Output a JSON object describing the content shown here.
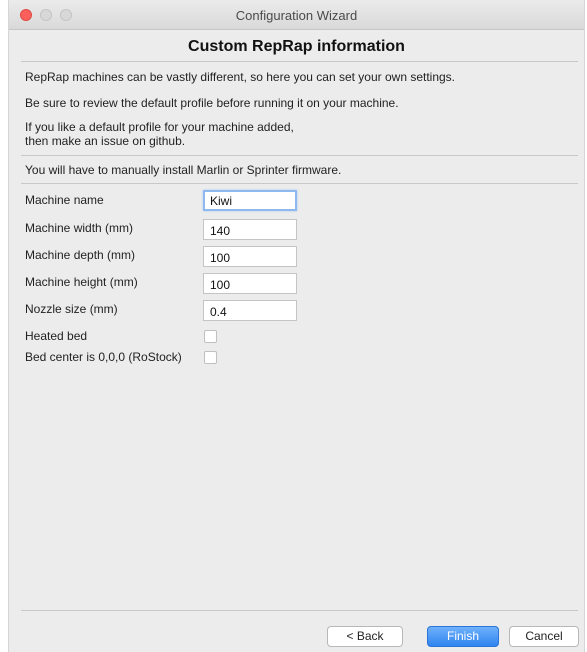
{
  "window": {
    "title": "Configuration Wizard"
  },
  "page": {
    "heading": "Custom RepRap information",
    "intro": [
      "RepRap machines can be vastly different, so here you can set your own settings.",
      "Be sure to review the default profile before running it on your machine.",
      "If you like a default profile for your machine added,",
      "then make an issue on github."
    ],
    "firmware_note": "You will have to manually install Marlin or Sprinter firmware."
  },
  "form": {
    "machine_name": {
      "label": "Machine name",
      "value": "Kiwi"
    },
    "machine_width": {
      "label": "Machine width (mm)",
      "value": "140"
    },
    "machine_depth": {
      "label": "Machine depth (mm)",
      "value": "100"
    },
    "machine_height": {
      "label": "Machine height (mm)",
      "value": "100"
    },
    "nozzle_size": {
      "label": "Nozzle size (mm)",
      "value": "0.4"
    },
    "heated_bed": {
      "label": "Heated bed",
      "checked": false
    },
    "bed_center": {
      "label": "Bed center is 0,0,0 (RoStock)",
      "checked": false
    }
  },
  "buttons": {
    "back": "< Back",
    "finish": "Finish",
    "cancel": "Cancel"
  },
  "colors": {
    "accent": "#2f84f0",
    "close_button": "#fc605c"
  }
}
